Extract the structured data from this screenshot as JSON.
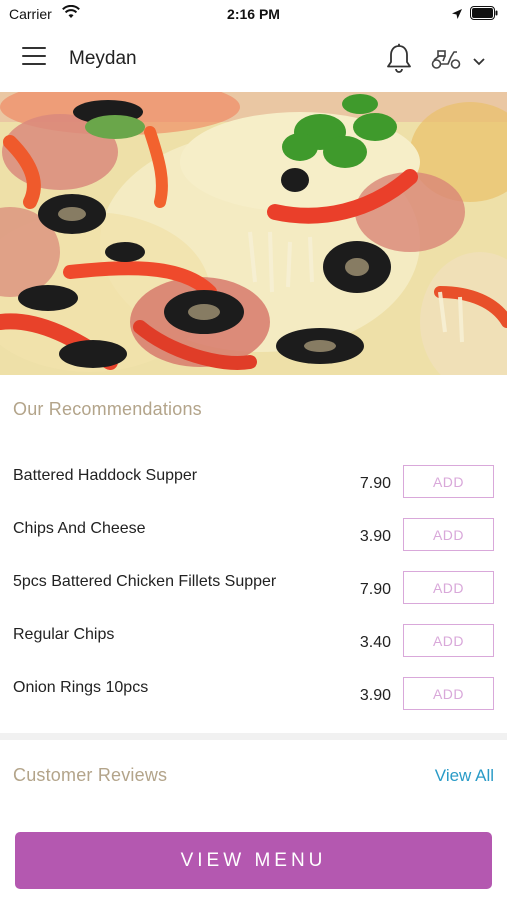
{
  "status_bar": {
    "carrier": "Carrier",
    "time": "2:16 PM",
    "icons": [
      "wifi-icon",
      "location-arrow-icon",
      "battery-icon"
    ]
  },
  "header": {
    "title": "Meydan",
    "icons": [
      "hamburger-menu-icon",
      "bell-icon",
      "scooter-icon",
      "chevron-down-icon"
    ]
  },
  "hero": {
    "image": "pizza-photo"
  },
  "recommendations": {
    "title": "Our Recommendations",
    "items": [
      {
        "name": "Battered Haddock Supper",
        "price": "7.90",
        "action": "ADD"
      },
      {
        "name": "Chips And Cheese",
        "price": "3.90",
        "action": "ADD"
      },
      {
        "name": "5pcs Battered Chicken Fillets Supper",
        "price": "7.90",
        "action": "ADD"
      },
      {
        "name": "Regular Chips",
        "price": "3.40",
        "action": "ADD"
      },
      {
        "name": "Onion Rings 10pcs",
        "price": "3.90",
        "action": "ADD"
      }
    ]
  },
  "reviews": {
    "title": "Customer Reviews",
    "view_all": "View All"
  },
  "footer": {
    "cta": "VIEW MENU"
  },
  "colors": {
    "accent": "#b458b0",
    "add_border": "#d9a8da",
    "section_title": "#b3a48a",
    "link": "#2a9bc7"
  }
}
